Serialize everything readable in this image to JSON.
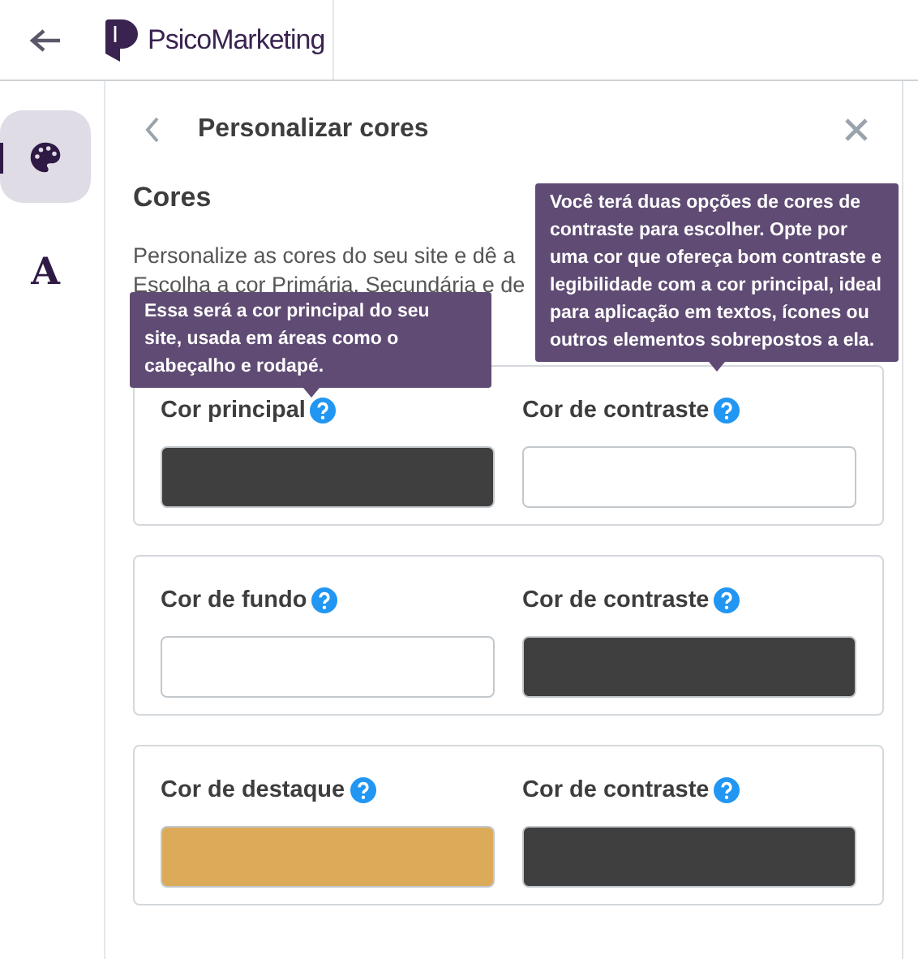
{
  "header": {
    "brand": "PsicoMarketing"
  },
  "rail": [
    {
      "kind": "palette",
      "selected": true
    },
    {
      "kind": "letter",
      "text": "A",
      "selected": false
    }
  ],
  "panel": {
    "title": "Personalizar cores",
    "section": "Cores",
    "description_lines": [
      "Personalize as cores do seu site e dê a",
      "Escolha a cor Primária, Secundária e de"
    ],
    "groups": [
      {
        "fields": [
          {
            "label": "Cor principal",
            "color": "#3f3f3f"
          },
          {
            "label": "Cor de contraste",
            "color": "#ffffff"
          }
        ]
      },
      {
        "fields": [
          {
            "label": "Cor de fundo",
            "color": "#ffffff"
          },
          {
            "label": "Cor de contraste",
            "color": "#3f3f3f"
          }
        ]
      },
      {
        "fields": [
          {
            "label": "Cor de destaque",
            "color": "#dcab5a"
          },
          {
            "label": "Cor de contraste",
            "color": "#3f3f3f"
          }
        ]
      }
    ],
    "tooltips": [
      {
        "kind": "main",
        "text": "Essa será a cor principal do seu site, usada em áreas como o cabeçalho e rodapé."
      },
      {
        "kind": "contrast",
        "text": "Você terá duas opções de cores de contraste para escolher. Opte por uma cor que ofereça bom contraste e legibilidade com a cor principal, ideal para aplicação em textos, ícones ou outros elementos sobrepostos a ela."
      }
    ]
  }
}
